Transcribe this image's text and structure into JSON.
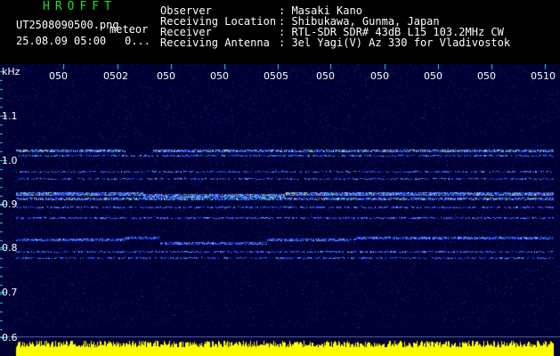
{
  "header": {
    "brand": "HROFFT",
    "filename": "UT2508090500.png",
    "date": "25.08.09 05:00",
    "event_label": "meteor",
    "event_count": "0...",
    "info_labels": [
      "Observer",
      "Receiving Location",
      "Receiver",
      "Receiving Antenna"
    ],
    "info_values": [
      ": Masaki Kano",
      ": Shibukawa, Gunma, Japan",
      ": RTL-SDR SDR# 43dB L15 103.2MHz CW",
      ": 3el Yagi(V) Az 330 for Vladivostok"
    ]
  },
  "axis": {
    "unit": "kHz",
    "y_ticks": [
      "1.1",
      "1.0",
      "0.9",
      "0.8",
      "0.7",
      "0.6"
    ],
    "time_ticks": [
      "050",
      "0502",
      "050",
      "050",
      "0505",
      "050",
      "050",
      "050",
      "050",
      "0510"
    ]
  },
  "colors": {
    "background": "#000033",
    "header_text": "#ffffff",
    "brand": "#22dd22",
    "ticks": "#29d9e6",
    "signal_bar": "#ffff00"
  }
}
